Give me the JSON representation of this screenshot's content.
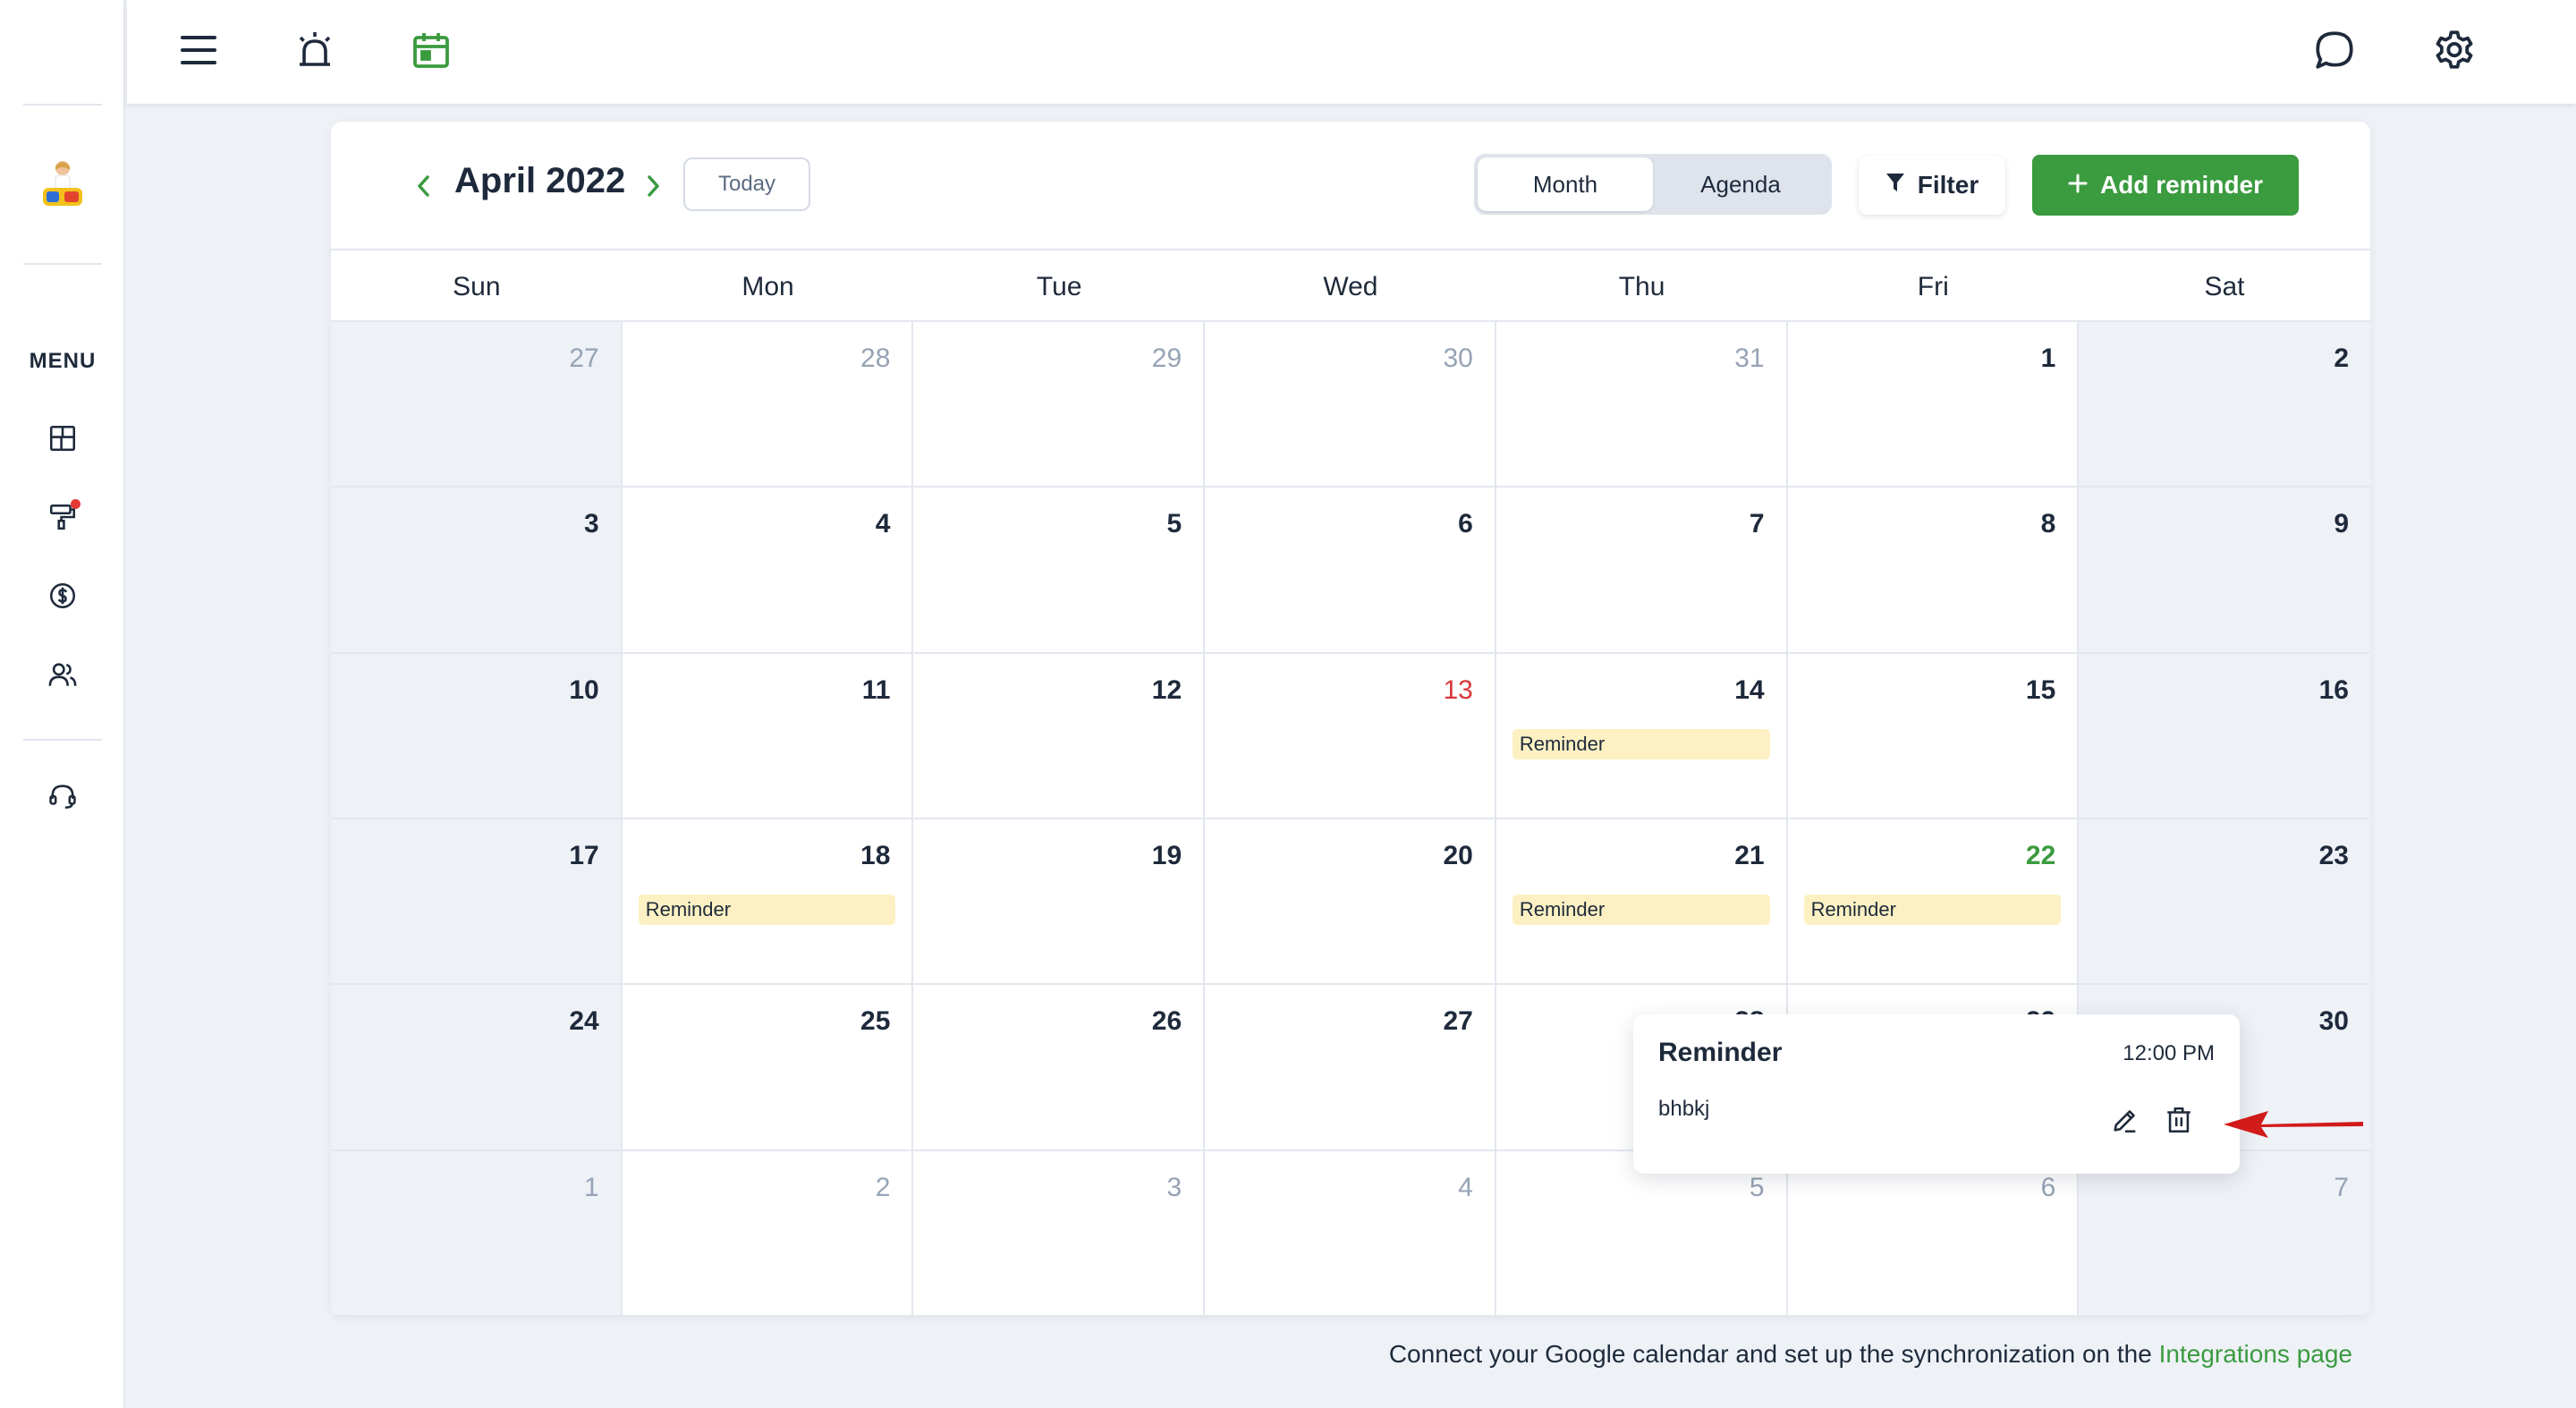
{
  "topbar": {
    "icons": [
      "menu-icon",
      "alarm-icon",
      "calendar-icon",
      "chat-icon",
      "gear-icon"
    ],
    "active_color": "#3a9b3f"
  },
  "sidebar": {
    "menu_label": "MENU",
    "icons": [
      "dashboard-icon",
      "paint-roller-icon",
      "dollar-icon",
      "users-icon",
      "headset-icon"
    ]
  },
  "calendar": {
    "title": "April 2022",
    "today_label": "Today",
    "views": [
      "Month",
      "Agenda"
    ],
    "active_view": "Month",
    "filter_label": "Filter",
    "add_label": "Add reminder",
    "weekdays": [
      "Sun",
      "Mon",
      "Tue",
      "Wed",
      "Thu",
      "Fri",
      "Sat"
    ],
    "weeks": [
      [
        {
          "d": "27",
          "m": true
        },
        {
          "d": "28",
          "m": true
        },
        {
          "d": "29",
          "m": true
        },
        {
          "d": "30",
          "m": true
        },
        {
          "d": "31",
          "m": true
        },
        {
          "d": "1"
        },
        {
          "d": "2"
        }
      ],
      [
        {
          "d": "3"
        },
        {
          "d": "4"
        },
        {
          "d": "5"
        },
        {
          "d": "6"
        },
        {
          "d": "7"
        },
        {
          "d": "8"
        },
        {
          "d": "9"
        }
      ],
      [
        {
          "d": "10"
        },
        {
          "d": "11"
        },
        {
          "d": "12"
        },
        {
          "d": "13",
          "today": true
        },
        {
          "d": "14",
          "event": "Reminder"
        },
        {
          "d": "15"
        },
        {
          "d": "16"
        }
      ],
      [
        {
          "d": "17"
        },
        {
          "d": "18",
          "event": "Reminder"
        },
        {
          "d": "19"
        },
        {
          "d": "20"
        },
        {
          "d": "21",
          "event": "Reminder"
        },
        {
          "d": "22",
          "selected": true,
          "event": "Reminder"
        },
        {
          "d": "23"
        }
      ],
      [
        {
          "d": "24"
        },
        {
          "d": "25"
        },
        {
          "d": "26"
        },
        {
          "d": "27"
        },
        {
          "d": "28"
        },
        {
          "d": "29"
        },
        {
          "d": "30"
        }
      ],
      [
        {
          "d": "1",
          "m": true
        },
        {
          "d": "2",
          "m": true
        },
        {
          "d": "3",
          "m": true
        },
        {
          "d": "4",
          "m": true
        },
        {
          "d": "5",
          "m": true
        },
        {
          "d": "6",
          "m": true
        },
        {
          "d": "7",
          "m": true
        }
      ]
    ]
  },
  "popup": {
    "title": "Reminder",
    "time": "12:00 PM",
    "description": "bhbkj"
  },
  "footer": {
    "text": "Connect your Google calendar and set up the synchronization on the ",
    "link": "Integrations page"
  }
}
